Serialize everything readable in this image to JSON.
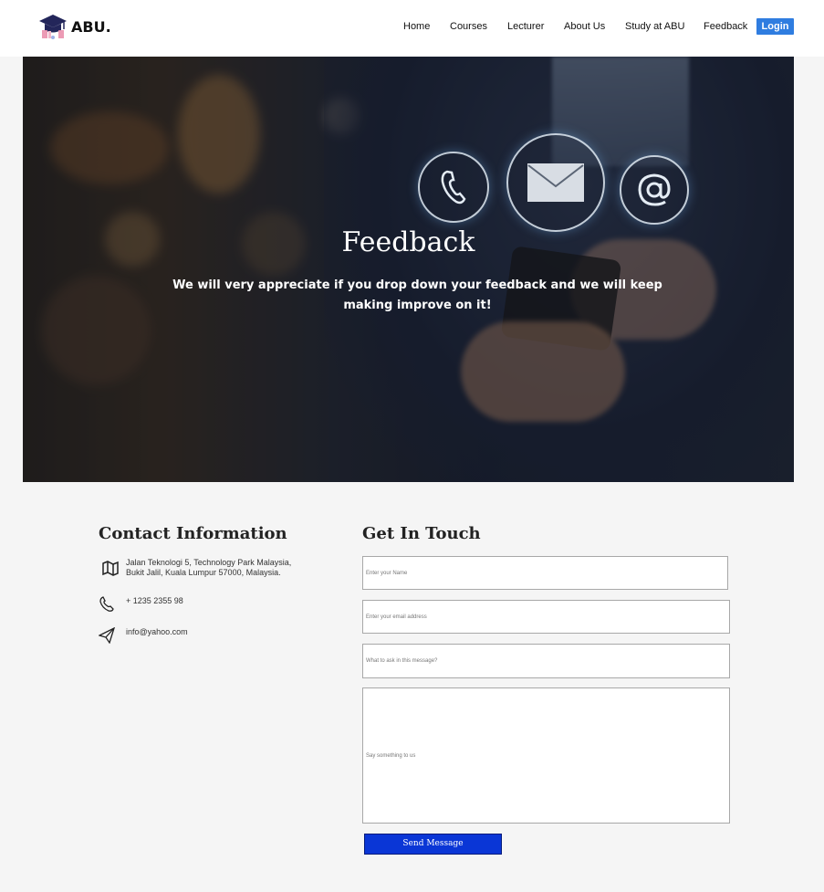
{
  "brand": {
    "name": "ABU."
  },
  "nav": {
    "items": [
      {
        "label": "Home"
      },
      {
        "label": "Courses"
      },
      {
        "label": "Lecturer"
      },
      {
        "label": "About Us"
      },
      {
        "label": "Study at ABU"
      },
      {
        "label": "Feedback"
      }
    ],
    "login_label": "Login"
  },
  "hero": {
    "title": "Feedback",
    "subtitle": "We will very appreciate if you drop down your feedback and we will keep making improve on it!",
    "icons": [
      "phone-icon",
      "mail-icon",
      "at-icon"
    ]
  },
  "contact": {
    "title": "Contact Information",
    "address_line1": "Jalan Teknologi 5, Technology Park Malaysia,",
    "address_line2": "Bukit Jalil, Kuala Lumpur 57000, Malaysia.",
    "phone": "+ 1235 2355 98",
    "email": "info@yahoo.com"
  },
  "form": {
    "title": "Get In Touch",
    "name_placeholder": "Enter your Name",
    "email_placeholder": "Enter your email address",
    "subject_placeholder": "What to ask in this message?",
    "message_placeholder": "Say something to us",
    "submit_label": "Send Message"
  },
  "colors": {
    "accent": "#2f7de0",
    "submit": "#0a36d6",
    "background": "#f5f5f5"
  }
}
